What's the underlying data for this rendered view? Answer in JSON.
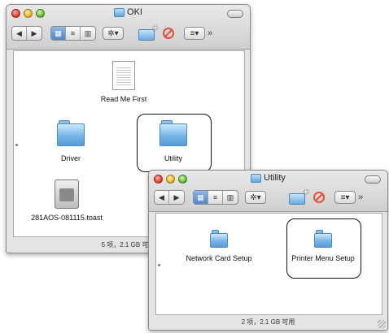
{
  "window1": {
    "title": "OKI",
    "status": "5 项，2.1 GB 可用",
    "items": [
      {
        "label": "Read Me First",
        "icon": "document-icon"
      },
      {
        "label": "Driver",
        "icon": "folder-icon"
      },
      {
        "label": "Utility",
        "icon": "folder-icon",
        "selected": true
      },
      {
        "label": "281AOS-081115.toast",
        "icon": "disk-image-icon"
      }
    ]
  },
  "window2": {
    "title": "Utility",
    "status": "2 项，2.1 GB 可用",
    "items": [
      {
        "label": "Network Card Setup",
        "icon": "folder-icon"
      },
      {
        "label": "Printer Menu Setup",
        "icon": "folder-icon",
        "selected": true
      }
    ]
  },
  "toolbar": {
    "back_icon": "◀",
    "forward_icon": "▶",
    "view_icon": "▦",
    "list_icon": "≡",
    "column_icon": "▥",
    "action_icon": "✲▾",
    "path_icon": "≡▾",
    "overflow_icon": "»"
  },
  "colors": {
    "folder": "#6fb1e4",
    "selection_border": "#111111"
  }
}
